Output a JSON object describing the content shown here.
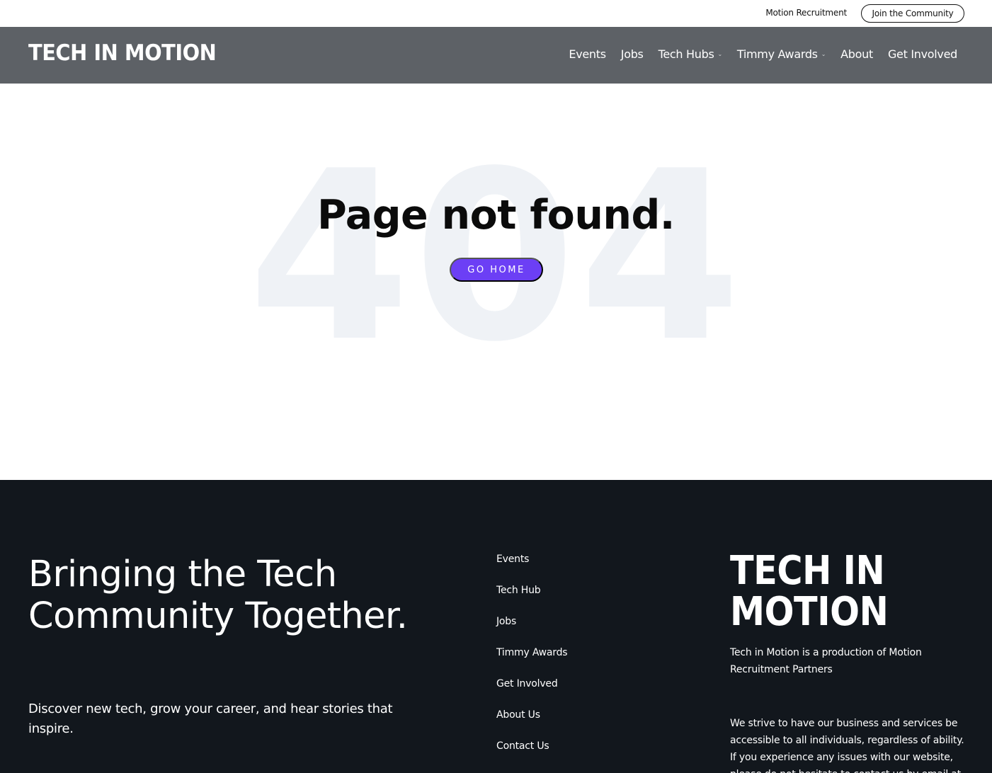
{
  "utility_bar": {
    "motion_link": "Motion Recruitment",
    "join_button": "Join the Community"
  },
  "header": {
    "logo": "TECH IN MOTION",
    "nav": [
      {
        "label": "Events"
      },
      {
        "label": "Jobs"
      },
      {
        "label": "Tech Hubs",
        "dropdown": true
      },
      {
        "label": "Timmy Awards",
        "dropdown": true
      },
      {
        "label": "About"
      },
      {
        "label": "Get Involved"
      }
    ]
  },
  "main": {
    "background_number": "404",
    "title": "Page not found.",
    "button": "GO HOME"
  },
  "footer": {
    "tagline": "Bringing the Tech Community Together.",
    "subtagline": "Discover new tech, grow your career, and hear stories that inspire.",
    "links": [
      "Events",
      "Tech Hub",
      "Jobs",
      "Timmy Awards",
      "Get Involved",
      "About Us",
      "Contact Us"
    ],
    "logo": "TECH IN MOTION",
    "production_note": "Tech in Motion is a production of Motion Recruitment Partners",
    "accessibility_note": "We strive to have our business and services be accessible to all individuals, regardless of ability. If you experience any issues with our website, please do not hesitate to contact us by email at"
  },
  "colors": {
    "nav_bg": "#5d6166",
    "accent": "#6c3ff5",
    "footer_bg": "#12171d",
    "watermark": "#eff2f6"
  }
}
